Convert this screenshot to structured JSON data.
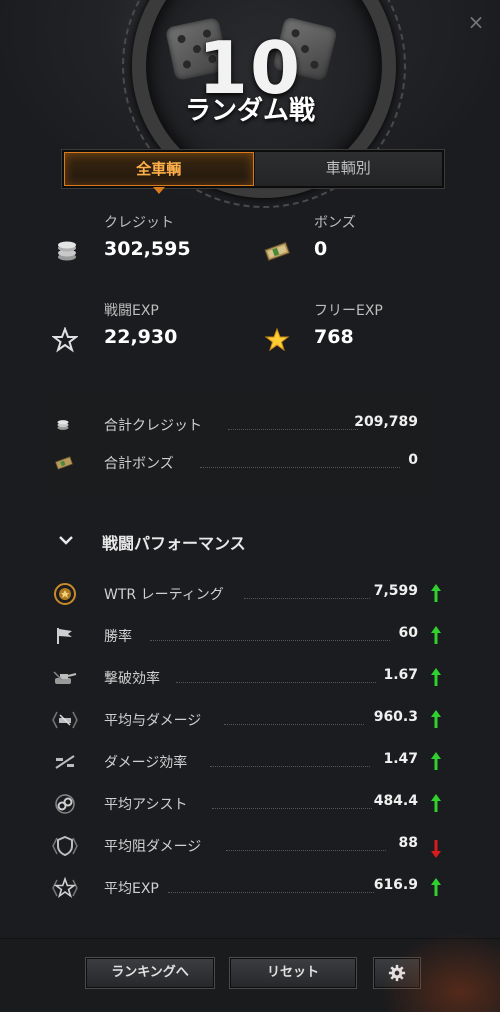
{
  "header": {
    "battles_count": "10",
    "mode_title": "ランダム戦",
    "close_glyph": "×"
  },
  "tabs": [
    {
      "label": "全車輌",
      "active": true
    },
    {
      "label": "車輌別",
      "active": false
    }
  ],
  "earnings": {
    "credits": {
      "label": "クレジット",
      "value": "302,595",
      "icon": "credits-coins-icon"
    },
    "bonds": {
      "label": "ボンズ",
      "value": "0",
      "icon": "bonds-icon"
    },
    "battle_exp": {
      "label": "戦闘EXP",
      "value": "22,930",
      "icon": "star-outline-icon"
    },
    "free_exp": {
      "label": "フリーEXP",
      "value": "768",
      "icon": "gold-star-icon"
    }
  },
  "totals": [
    {
      "label": "合計クレジット",
      "value": "209,789",
      "icon": "credits-coins-icon"
    },
    {
      "label": "合計ボンズ",
      "value": "0",
      "icon": "bonds-icon"
    }
  ],
  "performance": {
    "title": "戦闘パフォーマンス",
    "rows": [
      {
        "label": "WTR レーティング",
        "value": "7,599",
        "trend": "up",
        "icon": "wtr-badge-icon"
      },
      {
        "label": "勝率",
        "value": "60",
        "trend": "up",
        "icon": "flag-icon"
      },
      {
        "label": "撃破効率",
        "value": "1.67",
        "trend": "up",
        "icon": "destroyed-tank-icon"
      },
      {
        "label": "平均与ダメージ",
        "value": "960.3",
        "trend": "up",
        "icon": "damage-dealt-icon"
      },
      {
        "label": "ダメージ効率",
        "value": "1.47",
        "trend": "up",
        "icon": "damage-ratio-icon"
      },
      {
        "label": "平均アシスト",
        "value": "484.4",
        "trend": "up",
        "icon": "assist-icon"
      },
      {
        "label": "平均阻ダメージ",
        "value": "88",
        "trend": "down",
        "icon": "blocked-damage-icon"
      },
      {
        "label": "平均EXP",
        "value": "616.9",
        "trend": "up",
        "icon": "exp-star-icon"
      }
    ]
  },
  "footer": {
    "ranking_label": "ランキングへ",
    "reset_label": "リセット",
    "settings_icon": "gear-icon"
  },
  "colors": {
    "accent_orange": "#d97a1c",
    "trend_up": "#2fd12f",
    "trend_down": "#d81b1b",
    "gold_star": "#ffcc33"
  }
}
